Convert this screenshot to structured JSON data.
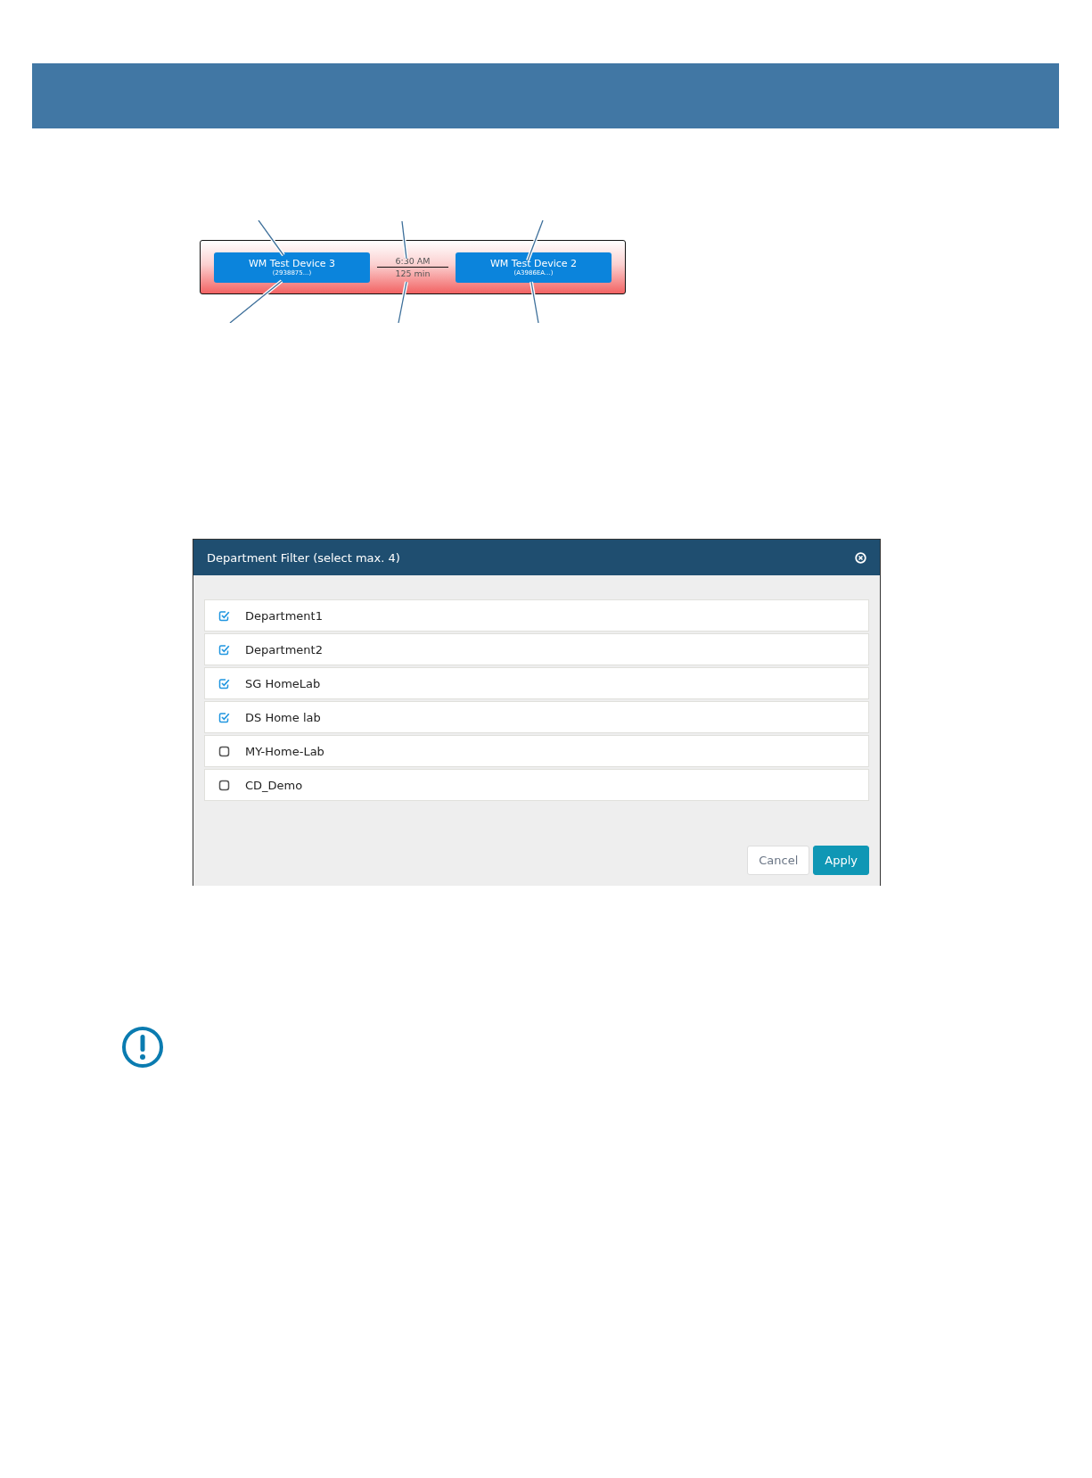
{
  "connection_strip": {
    "devices": [
      {
        "name": "WM Test Device 3",
        "id": "(2938875...)"
      },
      {
        "name": "WM Test Device 2",
        "id": "(A3986EA...)"
      }
    ],
    "time": "6:30 AM",
    "duration": "125 min"
  },
  "dialog": {
    "title": "Department Filter (select max. 4)",
    "items": [
      {
        "label": "Department1",
        "checked": true
      },
      {
        "label": "Department2",
        "checked": true
      },
      {
        "label": "SG HomeLab",
        "checked": true
      },
      {
        "label": "DS Home lab",
        "checked": true
      },
      {
        "label": "MY-Home-Lab",
        "checked": false
      },
      {
        "label": "CD_Demo",
        "checked": false
      }
    ],
    "buttons": [
      {
        "label": "Cancel",
        "kind": "secondary"
      },
      {
        "label": "Apply",
        "kind": "primary"
      }
    ]
  }
}
